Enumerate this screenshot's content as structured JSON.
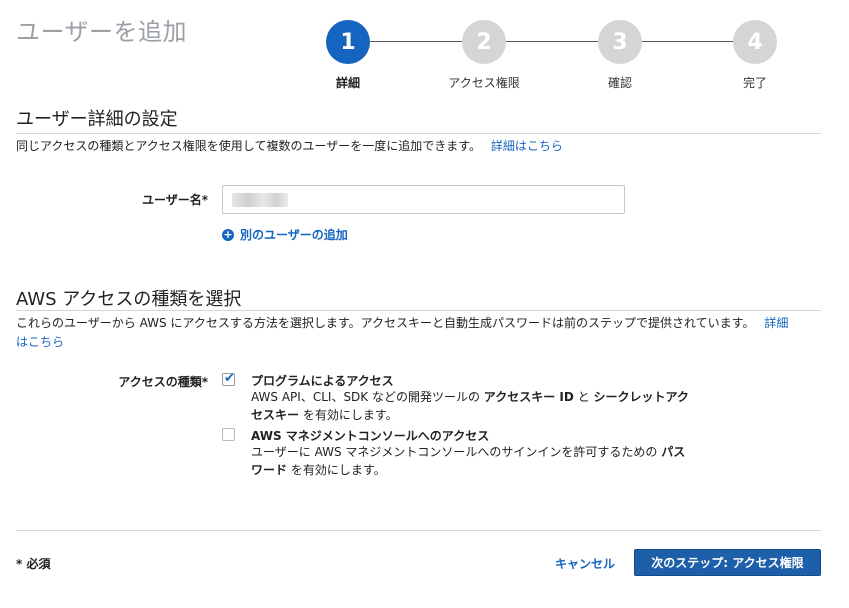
{
  "page": {
    "title": "ユーザーを追加"
  },
  "steps": [
    {
      "number": "1",
      "label": "詳細",
      "active": true
    },
    {
      "number": "2",
      "label": "アクセス権限",
      "active": false
    },
    {
      "number": "3",
      "label": "確認",
      "active": false
    },
    {
      "number": "4",
      "label": "完了",
      "active": false
    }
  ],
  "user_details": {
    "title": "ユーザー詳細の設定",
    "description": "同じアクセスの種類とアクセス権限を使用して複数のユーザーを一度に追加できます。",
    "learn_more": "詳細はこちら",
    "username_label": "ユーザー名*",
    "username_value": "",
    "add_user_link": "別のユーザーの追加"
  },
  "access_type": {
    "title": "AWS アクセスの種類を選択",
    "description": "これらのユーザーから AWS にアクセスする方法を選択します。アクセスキーと自動生成パスワードは前のステップで提供されています。",
    "learn_more_1": "詳細",
    "learn_more_2": "はこちら",
    "label": "アクセスの種類*",
    "options": [
      {
        "title": "プログラムによるアクセス",
        "checked": true,
        "desc_parts": [
          "AWS API、CLI、SDK などの開発ツールの ",
          "アクセスキー ID",
          " と ",
          "シークレットアク",
          "セスキー",
          " を有効にします。"
        ]
      },
      {
        "title": "AWS マネジメントコンソールへのアクセス",
        "checked": false,
        "desc_parts": [
          "ユーザーに AWS マネジメントコンソールへのサインインを許可するための ",
          "パス",
          "ワード",
          " を有効にします。"
        ]
      }
    ]
  },
  "footer": {
    "required_note": "* 必須",
    "cancel_label": "キャンセル",
    "next_label": "次のステップ: アクセス権限"
  },
  "colors": {
    "accent": "#1464c0",
    "step_inactive": "#d5d5d5",
    "button": "#1d5fa8"
  }
}
